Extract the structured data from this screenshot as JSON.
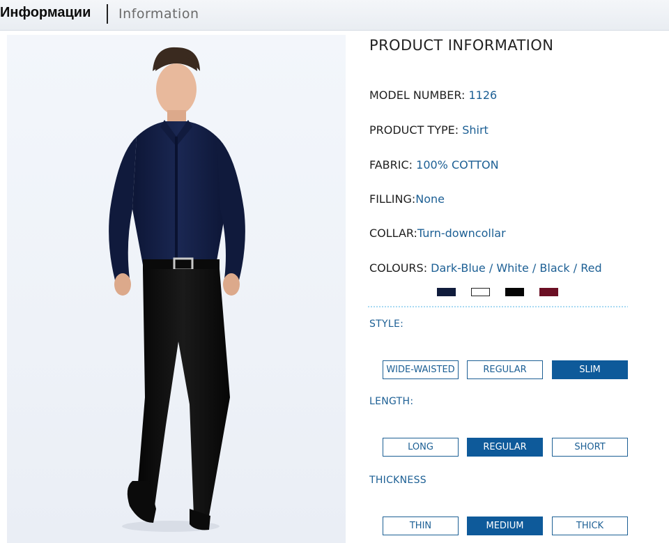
{
  "header": {
    "title_ru": "Информации",
    "title_en": "Information"
  },
  "product": {
    "heading": "PRODUCT INFORMATION",
    "specs": [
      {
        "label": "MODEL NUMBER: ",
        "value": "1126"
      },
      {
        "label": "PRODUCT TYPE: ",
        "value": "Shirt"
      },
      {
        "label": "FABRIC: ",
        "value": "100% COTTON"
      },
      {
        "label": "FILLING:",
        "value": "None"
      },
      {
        "label": "COLLAR:",
        "value": "Turn-downcollar"
      },
      {
        "label": "COLOURS: ",
        "value": "Dark-Blue / White / Black / Red"
      }
    ],
    "swatches": [
      {
        "name": "dark-blue",
        "color": "#101c3c"
      },
      {
        "name": "white",
        "color": "#ffffff"
      },
      {
        "name": "black",
        "color": "#050505"
      },
      {
        "name": "red",
        "color": "#6b0f24"
      }
    ]
  },
  "style": {
    "label": "STYLE:",
    "options": [
      "WIDE-WAISTED",
      "REGULAR",
      "SLIM"
    ],
    "selected": "SLIM"
  },
  "length": {
    "label": "LENGTH:",
    "options": [
      "LONG",
      "REGULAR",
      "SHORT"
    ],
    "selected": "REGULAR"
  },
  "thickness": {
    "label": "THICKNESS",
    "options": [
      "THIN",
      "MEDIUM",
      "THICK"
    ],
    "selected": "MEDIUM"
  },
  "colors": {
    "accent": "#1c5f94",
    "active_bg": "#0e5a9a",
    "shirt": "#131e44",
    "trousers": "#101010"
  }
}
